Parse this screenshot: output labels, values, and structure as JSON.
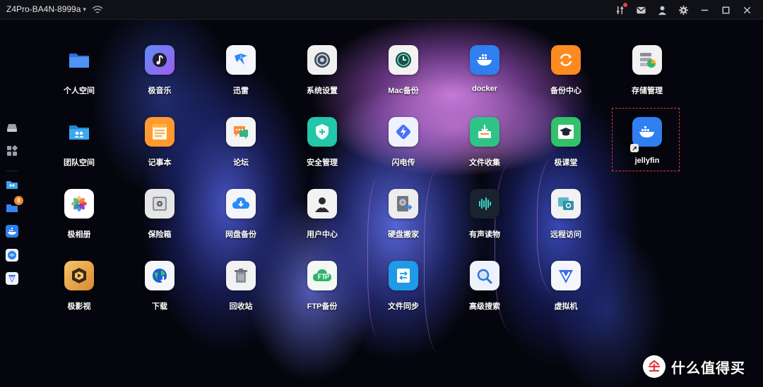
{
  "titlebar": {
    "device_name": "Z4Pro-BA4N-8999a",
    "chevron": "▾",
    "icons": [
      "wifi-icon",
      "tune-icon",
      "mail-icon",
      "user-icon",
      "gear-icon",
      "minimize-icon",
      "maximize-icon",
      "close-icon"
    ]
  },
  "sidebar": {
    "items": [
      {
        "name": "drive-icon"
      },
      {
        "name": "apps-grid-icon"
      },
      {
        "name": "team-folder-icon"
      },
      {
        "name": "folder-icon",
        "badge": "8"
      },
      {
        "name": "docker-icon"
      },
      {
        "name": "jellyfin-icon"
      },
      {
        "name": "vm-icon"
      }
    ]
  },
  "apps": [
    {
      "label": "个人空间",
      "icon": "personal-folder-icon",
      "color": "#3b82f6"
    },
    {
      "label": "极音乐",
      "icon": "music-icon",
      "color": "#7c6cf0"
    },
    {
      "label": "迅雷",
      "icon": "thunder-icon",
      "color": "#f4f6fb"
    },
    {
      "label": "系统设置",
      "icon": "settings-icon",
      "color": "#f0f0f0"
    },
    {
      "label": "Mac备份",
      "icon": "time-machine-icon",
      "color": "#f2f2f2"
    },
    {
      "label": "docker",
      "icon": "docker-icon",
      "color": "#2f7ff0"
    },
    {
      "label": "备份中心",
      "icon": "sync-icon",
      "color": "#ff8a1f"
    },
    {
      "label": "存储管理",
      "icon": "storage-icon",
      "color": "#f2f2f2"
    },
    {
      "label": "团队空间",
      "icon": "team-folder-icon",
      "color": "#3ba3ec"
    },
    {
      "label": "记事本",
      "icon": "notepad-icon",
      "color": "#ff9a30"
    },
    {
      "label": "论坛",
      "icon": "forum-icon",
      "color": "#f4f4f4"
    },
    {
      "label": "安全管理",
      "icon": "shield-icon",
      "color": "#22c6a8"
    },
    {
      "label": "闪电传",
      "icon": "flash-transfer-icon",
      "color": "#eef2ff"
    },
    {
      "label": "文件收集",
      "icon": "file-collect-icon",
      "color": "#2ec486"
    },
    {
      "label": "极课堂",
      "icon": "graduation-cap-icon",
      "color": "#31c26a"
    },
    {
      "label": "jellyfin",
      "icon": "jellyfin-docker-icon",
      "color": "#2f7ff0"
    },
    {
      "label": "极相册",
      "icon": "photos-icon",
      "color": "#ffffff"
    },
    {
      "label": "保险箱",
      "icon": "safe-icon",
      "color": "#e6e6e6"
    },
    {
      "label": "网盘备份",
      "icon": "cloud-backup-icon",
      "color": "#f4f6fa"
    },
    {
      "label": "用户中心",
      "icon": "user-center-icon",
      "color": "#f2f2f2"
    },
    {
      "label": "硬盘搬家",
      "icon": "disk-migrate-icon",
      "color": "#ededed"
    },
    {
      "label": "有声读物",
      "icon": "audiobook-icon",
      "color": "#1a2230"
    },
    {
      "label": "远程访问",
      "icon": "remote-access-icon",
      "color": "#f2f2f2"
    },
    {
      "label": "极影视",
      "icon": "video-icon",
      "color": "#f0b050"
    },
    {
      "label": "下载",
      "icon": "download-globe-icon",
      "color": "#f4f6fa"
    },
    {
      "label": "回收站",
      "icon": "trash-icon",
      "color": "#f2f2f2"
    },
    {
      "label": "FTP备份",
      "icon": "ftp-cloud-icon",
      "color": "#f4f8f4"
    },
    {
      "label": "文件同步",
      "icon": "file-sync-icon",
      "color": "#1f9ae8"
    },
    {
      "label": "高级搜索",
      "icon": "search-icon",
      "color": "#eef3fb"
    },
    {
      "label": "虚拟机",
      "icon": "vm-icon",
      "color": "#f4f6fa"
    }
  ],
  "selected_app": "jellyfin",
  "watermark": {
    "text": "什么值得买",
    "logo": "zhi-logo"
  }
}
